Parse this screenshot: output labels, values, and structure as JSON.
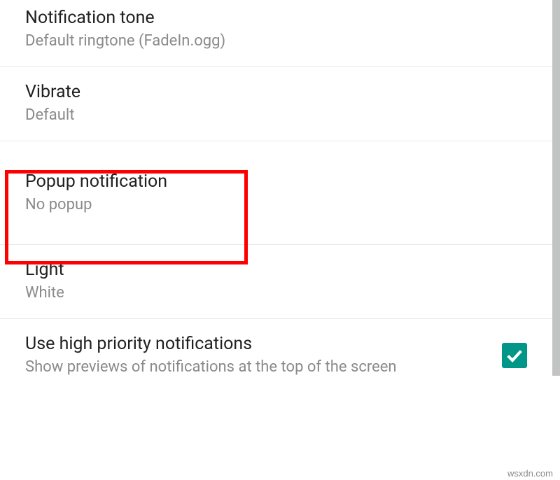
{
  "items": {
    "tone": {
      "title": "Notification tone",
      "subtitle": "Default ringtone (FadeIn.ogg)"
    },
    "vibrate": {
      "title": "Vibrate",
      "subtitle": "Default"
    },
    "popup": {
      "title": "Popup notification",
      "subtitle": "No popup"
    },
    "light": {
      "title": "Light",
      "subtitle": "White"
    },
    "priority": {
      "title": "Use high priority notifications",
      "subtitle": "Show previews of notifications at the top of the screen"
    }
  },
  "watermark": "wsxdn.com"
}
